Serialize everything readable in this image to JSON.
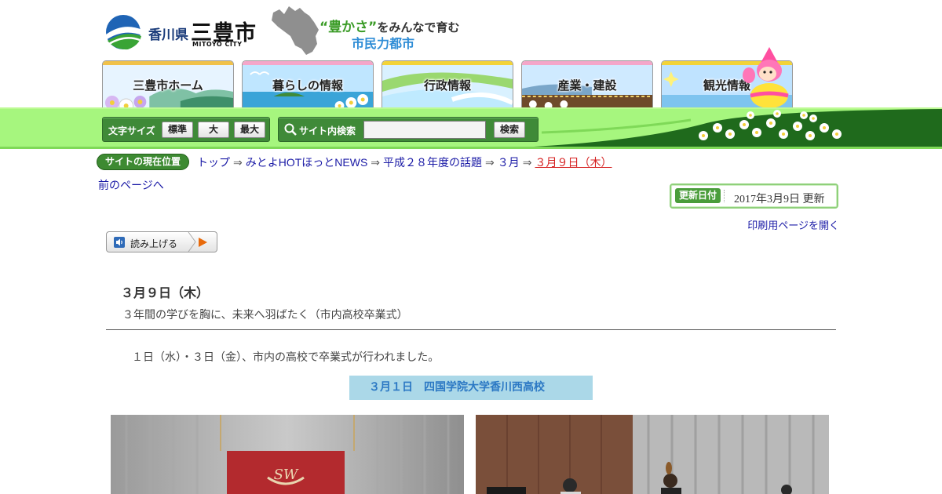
{
  "header": {
    "logo": {
      "pref": "香川県",
      "city": "三豊市",
      "city_en": "MITOYO CITY"
    },
    "tagline": {
      "quote": "“豊かさ”",
      "line1_rest": "をみんなで育む",
      "line2": "市民力都市"
    }
  },
  "nav": {
    "tabs": [
      {
        "label": "三豊市ホーム",
        "strip": "#f0c14a"
      },
      {
        "label": "暮らしの情報",
        "strip": "#f4a6c9"
      },
      {
        "label": "行政情報",
        "strip": "#f3d338"
      },
      {
        "label": "産業・建設",
        "strip": "#f4a6c9"
      },
      {
        "label": "観光情報",
        "strip": "#f3d338"
      }
    ]
  },
  "toolbar": {
    "font_size_label": "文字サイズ",
    "font_buttons": [
      "標準",
      "大",
      "最大"
    ],
    "search_label": "サイト内検索",
    "search_value": "",
    "search_button": "検索"
  },
  "breadcrumb": {
    "badge": "サイトの現在位置",
    "items": [
      "トップ",
      "みとよHOTほっとNEWS",
      "平成２８年度の話題",
      "３月",
      "３月９日（木）"
    ],
    "separator": "⇒"
  },
  "page": {
    "back_link": "前のページへ",
    "updated_badge": "更新日付",
    "updated_text": "2017年3月9日 更新",
    "print_link": "印刷用ページを開く",
    "read_aloud": "読み上げる"
  },
  "article": {
    "title": "３月９日（木）",
    "subtitle": "３年間の学びを胸に、未来へ羽ばたく（市内高校卒業式）",
    "body": "１日（水）・３日（金）、市内の高校で卒業式が行われました。",
    "section_heading": "３月１日　四国学院大学香川西高校"
  },
  "colors": {
    "green_dark": "#1f6a1c",
    "green_light": "#a6f67e",
    "link": "#1a1aa6",
    "current": "#d52020",
    "accent_blue": "#2b78c4"
  }
}
